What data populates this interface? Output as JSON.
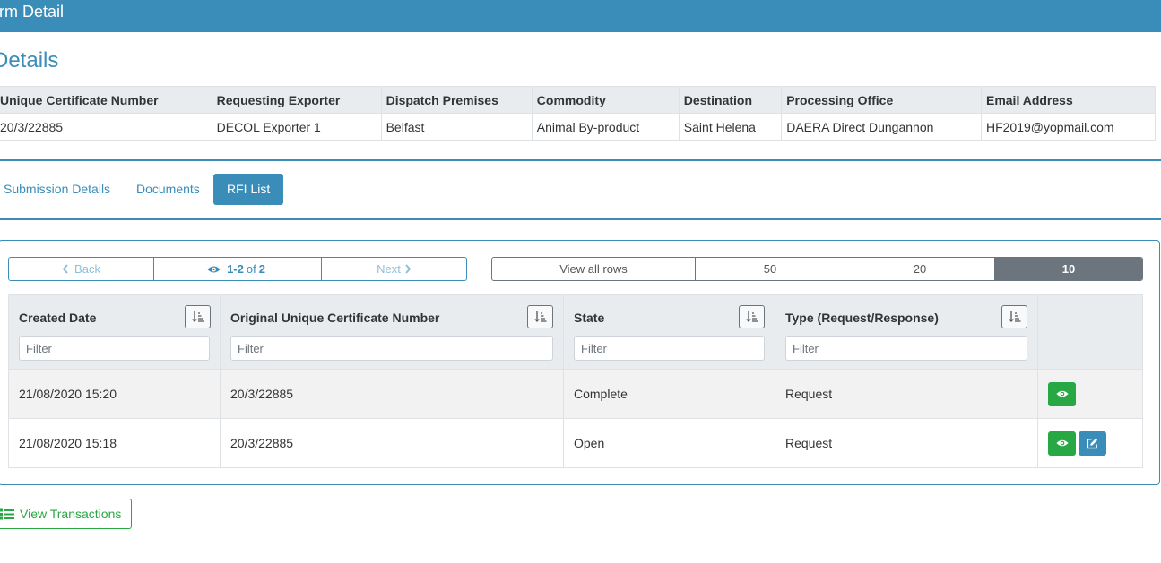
{
  "header": {
    "title": "orm Detail"
  },
  "section_title": "Details",
  "details_table": {
    "headers": [
      "Unique Certificate Number",
      "Requesting Exporter",
      "Dispatch Premises",
      "Commodity",
      "Destination",
      "Processing Office",
      "Email Address"
    ],
    "row": [
      "20/3/22885",
      "DECOL Exporter 1",
      "Belfast",
      "Animal By-product",
      "Saint Helena",
      "DAERA Direct Dungannon",
      "HF2019@yopmail.com"
    ]
  },
  "tabs": [
    {
      "label": "Submission Details",
      "active": false
    },
    {
      "label": "Documents",
      "active": false
    },
    {
      "label": "RFI List",
      "active": true
    }
  ],
  "pager": {
    "back": "Back",
    "range": "1-2",
    "of": "of",
    "total": "2",
    "next": "Next"
  },
  "rows_per_page": {
    "options": [
      "View all rows",
      "50",
      "20",
      "10"
    ],
    "selected": "10"
  },
  "grid": {
    "columns": [
      "Created Date",
      "Original Unique Certificate Number",
      "State",
      "Type (Request/Response)"
    ],
    "filter_placeholder": "Filter",
    "rows": [
      {
        "created": "21/08/2020 15:20",
        "certificate": "20/3/22885",
        "state": "Complete",
        "type": "Request",
        "actions": [
          "view"
        ]
      },
      {
        "created": "21/08/2020 15:18",
        "certificate": "20/3/22885",
        "state": "Open",
        "type": "Request",
        "actions": [
          "view",
          "edit"
        ]
      }
    ]
  },
  "transactions_button": {
    "label": "View Transactions"
  },
  "colors": {
    "primary": "#3a8db8",
    "success": "#28a745",
    "secondary": "#6c757d"
  },
  "icons": {
    "back": "chevron-left-icon",
    "next": "chevron-right-icon",
    "page_info": "eye-icon",
    "sort": "sort-amount-down-icon",
    "view": "eye-icon",
    "edit": "edit-icon",
    "transactions": "list-icon"
  }
}
